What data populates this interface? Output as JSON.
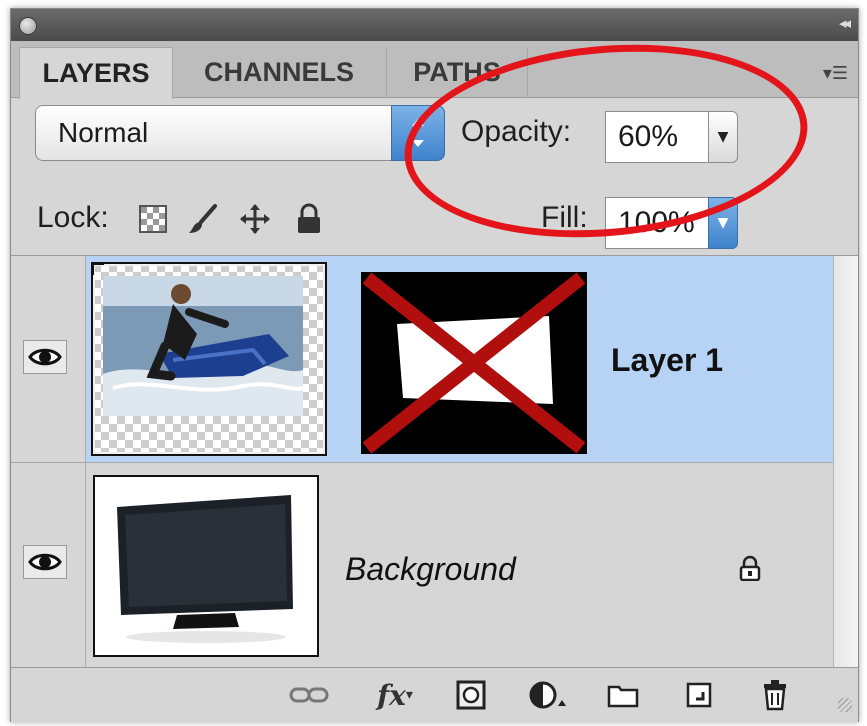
{
  "panel": {
    "tabs": [
      {
        "label": "LAYERS",
        "active": true
      },
      {
        "label": "CHANNELS",
        "active": false
      },
      {
        "label": "PATHS",
        "active": false
      }
    ]
  },
  "controls": {
    "blend_mode": "Normal",
    "opacity_label": "Opacity:",
    "opacity_value": "60%",
    "lock_label": "Lock:",
    "fill_label": "Fill:",
    "fill_value": "100%"
  },
  "layers": [
    {
      "name": "Layer 1",
      "selected": true,
      "visible": true,
      "has_mask": true,
      "locked": false
    },
    {
      "name": "Background",
      "selected": false,
      "visible": true,
      "has_mask": false,
      "locked": true
    }
  ],
  "bottom_icons": [
    "link-layers-icon",
    "fx-icon",
    "add-mask-icon",
    "adjustment-layer-icon",
    "new-group-icon",
    "new-layer-icon",
    "trash-icon"
  ],
  "colors": {
    "selection": "#b6d3f5",
    "highlight_circle": "#e3141a",
    "mask_x": "#b10e0e"
  }
}
